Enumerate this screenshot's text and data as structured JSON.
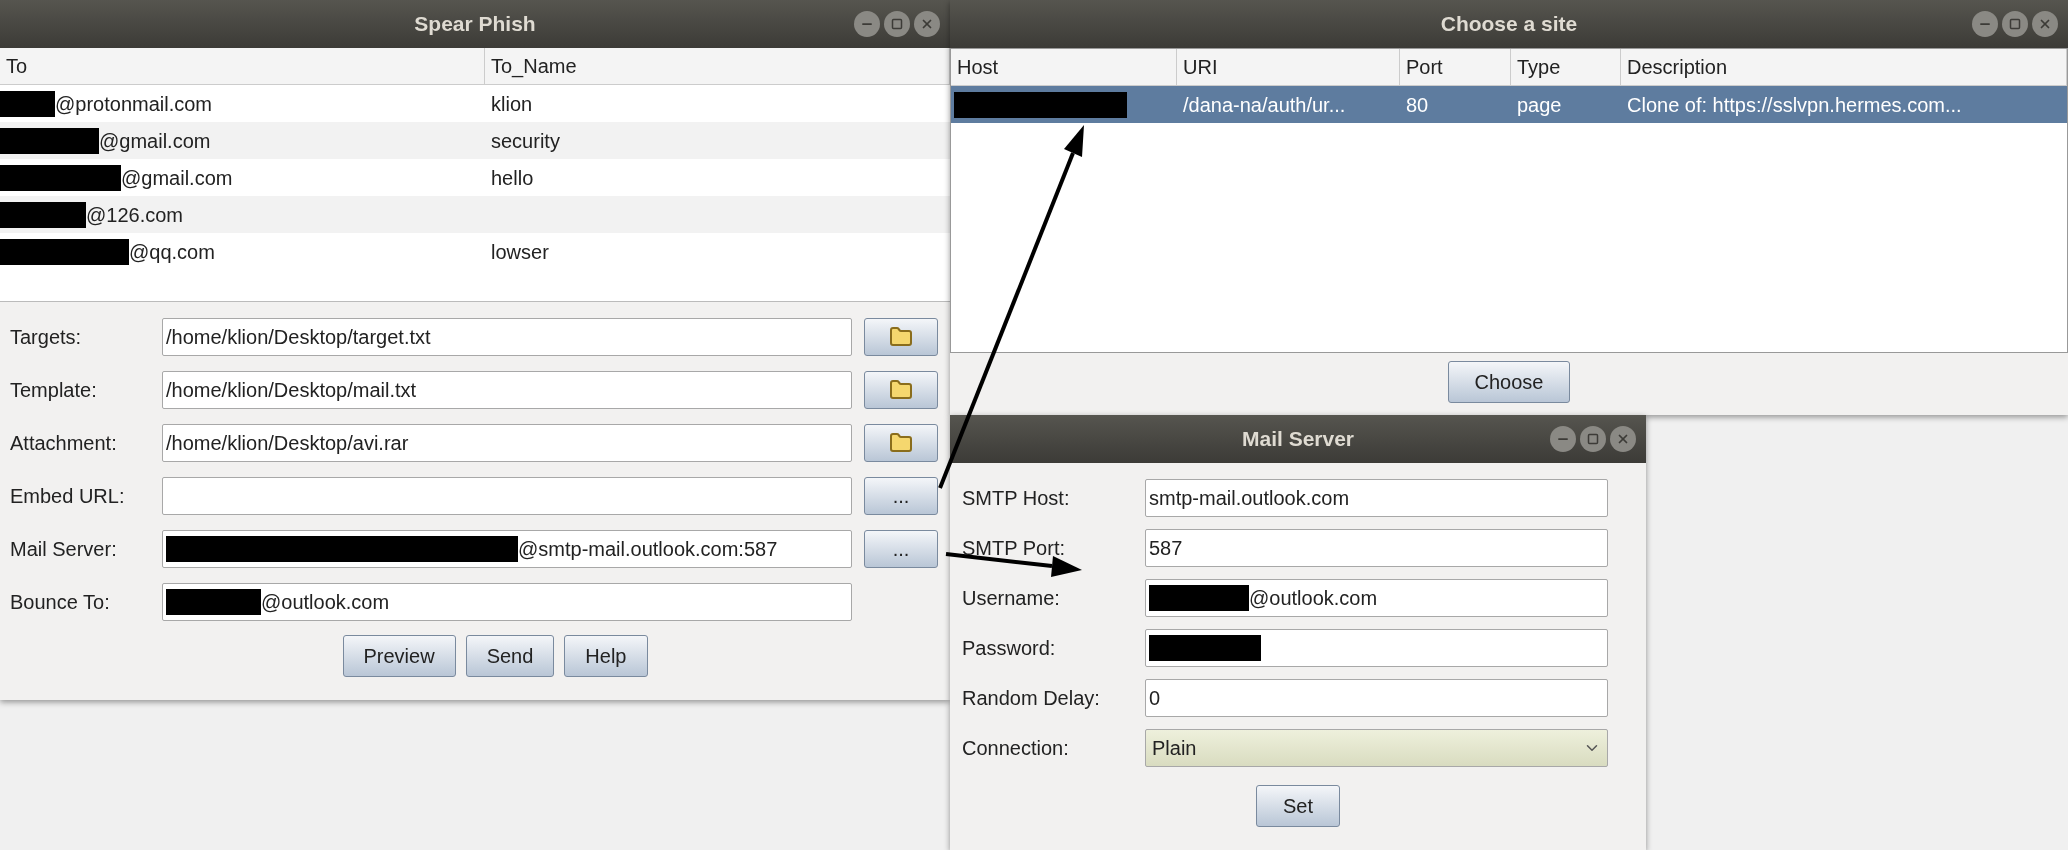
{
  "spear_phish": {
    "title": "Spear Phish",
    "columns": [
      "To",
      "To_Name"
    ],
    "rows": [
      {
        "to": "@protonmail.com",
        "to_name": "klion",
        "redacted": true
      },
      {
        "to": "@gmail.com",
        "to_name": "security",
        "redacted": true
      },
      {
        "to": "@gmail.com",
        "to_name": "hello",
        "redacted": true
      },
      {
        "to": "@126.com",
        "redacted": true
      },
      {
        "to": "@qq.com",
        "to_name": "lowser",
        "redacted": true
      }
    ],
    "fields": [
      {
        "label": "Targets:",
        "value": "/home/klion/Desktop/target.txt",
        "redacted": false,
        "kind": "folder"
      },
      {
        "label": "Template:",
        "value": "/home/klion/Desktop/mail.txt",
        "redacted": false,
        "kind": "folder"
      },
      {
        "label": "Attachment:",
        "value": "/home/klion/Desktop/avi.rar",
        "redacted": false,
        "kind": "folder"
      },
      {
        "label": "Embed URL:",
        "redacted": false,
        "kind": "more",
        "button_label": "..."
      },
      {
        "label": "Mail Server:",
        "value": "@smtp-mail.outlook.com:587",
        "redacted": true,
        "kind": "more",
        "button_label": "..."
      },
      {
        "label": "Bounce To:",
        "value": "@outlook.com",
        "redacted": true,
        "kind": "plain"
      }
    ],
    "buttons": [
      "Preview",
      "Send",
      "Help"
    ]
  },
  "choose_site": {
    "title": "Choose a site",
    "columns": [
      "Host",
      "URI",
      "Port",
      "Type",
      "Description"
    ],
    "rows": [
      {
        "selected": true,
        "host_redacted": true,
        "cells": [
          "",
          "/dana-na/auth/ur...",
          "80",
          "page",
          "Clone of: https://sslvpn.hermes.com..."
        ]
      }
    ],
    "button": "Choose"
  },
  "mail_server": {
    "title": "Mail Server",
    "fields": [
      {
        "label": "SMTP Host:",
        "kind": "text",
        "value": "smtp-mail.outlook.com",
        "redacted": false
      },
      {
        "label": "SMTP Port:",
        "kind": "text",
        "value": "587",
        "redacted": false
      },
      {
        "label": "Username:",
        "kind": "text",
        "value": "@outlook.com",
        "redacted": true
      },
      {
        "label": "Password:",
        "kind": "password",
        "redacted": true
      },
      {
        "label": "Random Delay:",
        "kind": "text",
        "value": "0",
        "redacted": false
      },
      {
        "label": "Connection:",
        "kind": "select",
        "value": "Plain",
        "redacted": false
      }
    ],
    "button": "Set"
  }
}
